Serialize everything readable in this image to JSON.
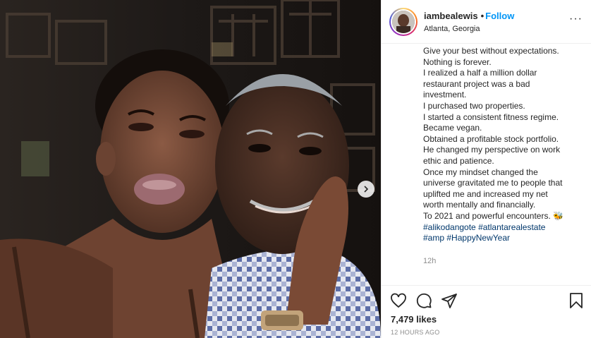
{
  "post": {
    "username": "iambealewis",
    "separator": "•",
    "follow_label": "Follow",
    "location": "Atlanta, Georgia",
    "more_label": "···",
    "caption_lines": [
      "Give your best without expectations.",
      "Nothing is forever.",
      "I realized a half a million dollar",
      "restaurant project was a bad",
      "investment.",
      "I purchased two properties.",
      "I started a consistent fitness regime.",
      "Became vegan.",
      "Obtained a profitable stock portfolio.",
      "He changed my perspective on work",
      "ethic and patience.",
      "Once my mindset changed the",
      "universe gravitated me to people that",
      "uplifted me and increased my net",
      "worth mentally and financially.",
      "To 2021 and powerful encounters. 🐝"
    ],
    "hashtags_line1": [
      "#alikodangote",
      "#atlantarealestate"
    ],
    "hashtags_line2": [
      "#amp",
      "#HappyNewYear"
    ],
    "caption_time": "12h",
    "likes": "7,479 likes",
    "posted_ago": "12 HOURS AGO"
  },
  "icons": {
    "like": "heart-icon",
    "comment": "comment-icon",
    "share": "share-icon",
    "save": "bookmark-icon",
    "carousel": "chevron-right-icon"
  },
  "colors": {
    "follow": "#0095f6",
    "hashtag": "#00376b",
    "muted": "#8e8e8e",
    "text": "#262626"
  }
}
